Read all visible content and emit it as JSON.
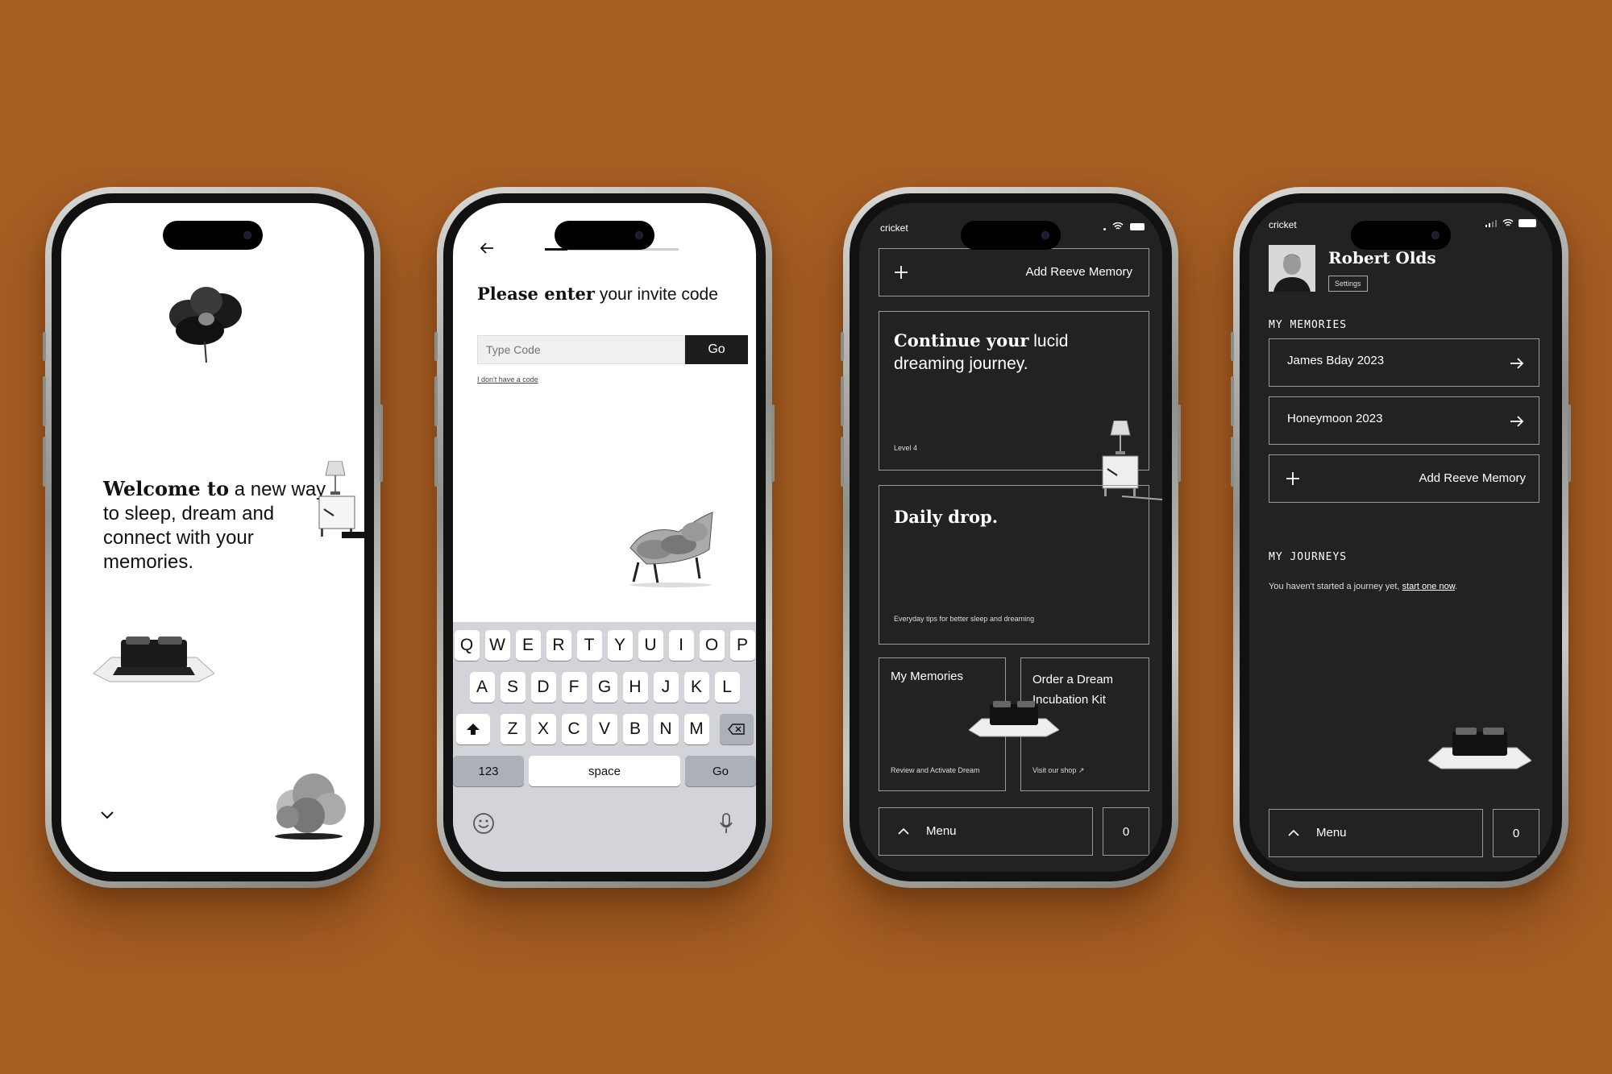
{
  "colors": {
    "background": "#a55d22",
    "screen_dark": "#222222",
    "border_dark": "#9a9a9a",
    "accent_black": "#1d1d1d"
  },
  "phone1": {
    "welcome_bold": "Welcome to",
    "welcome_rest": " a new way to sleep, dream and connect with your memories.",
    "icons": [
      "flower-illustration",
      "nightstand-lamp-illustration",
      "bed-illustration",
      "cloud-illustration",
      "chevron-down-icon"
    ]
  },
  "phone2": {
    "title_bold": "Please enter",
    "title_rest": " your invite code",
    "input_placeholder": "Type Code",
    "go_label": "Go",
    "no_code_link": "I don't have a code",
    "progress_fraction": 0.17,
    "keyboard": {
      "row1": [
        "Q",
        "W",
        "E",
        "R",
        "T",
        "Y",
        "U",
        "I",
        "O",
        "P"
      ],
      "row2": [
        "A",
        "S",
        "D",
        "F",
        "G",
        "H",
        "J",
        "K",
        "L"
      ],
      "row3": [
        "Z",
        "X",
        "C",
        "V",
        "B",
        "N",
        "M"
      ],
      "numbers_label": "123",
      "space_label": "space",
      "go_label": "Go"
    }
  },
  "phone3": {
    "carrier": "cricket",
    "add_memory_label": "Add Reeve Memory",
    "journey_title_bold": "Continue your",
    "journey_title_rest": " lucid dreaming journey.",
    "journey_level": "Level 4",
    "daily_title": "Daily drop.",
    "daily_sub": "Everyday tips for better sleep and dreaming",
    "memories_label": "My Memories",
    "memories_sub": "Review and Activate Dream",
    "order_label": "Order a Dream Incubation Kit",
    "order_sub": "Visit our shop ↗",
    "menu_label": "Menu",
    "cart_count": "0"
  },
  "phone4": {
    "carrier": "cricket",
    "user_name": "Robert Olds",
    "settings_label": "Settings",
    "memories_heading": "MY MEMORIES",
    "memories": [
      "James Bday 2023",
      "Honeymoon 2023"
    ],
    "add_memory_label": "Add Reeve Memory",
    "journeys_heading": "MY JOURNEYS",
    "journeys_text": "You haven't started a journey yet, ",
    "journeys_link": "start one now",
    "journeys_end": ".",
    "menu_label": "Menu",
    "cart_count": "0"
  }
}
